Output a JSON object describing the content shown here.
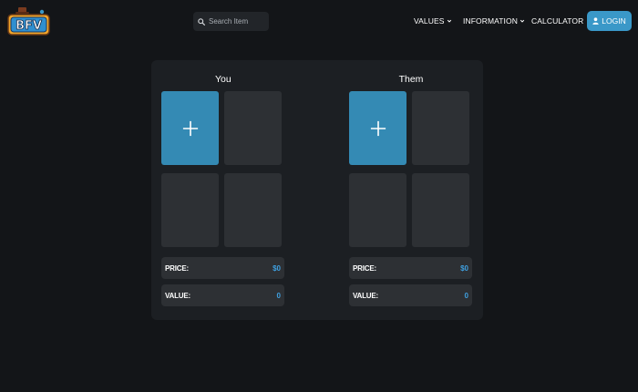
{
  "header": {
    "logo_text": "BFV",
    "search": {
      "placeholder": "Search Item",
      "value": ""
    },
    "nav": {
      "values_label": "VALUES",
      "information_label": "INFORMATION",
      "calculator_label": "CALCULATOR"
    },
    "login_label": "LOGIN"
  },
  "trade": {
    "you": {
      "title": "You",
      "price_label": "PRICE:",
      "price_value": "$0",
      "value_label": "VALUE:",
      "value_value": "0"
    },
    "them": {
      "title": "Them",
      "price_label": "PRICE:",
      "price_value": "$0",
      "value_label": "VALUE:",
      "value_value": "0"
    }
  },
  "colors": {
    "background": "#131518",
    "panel": "#1c1f23",
    "slot": "#2d3034",
    "add_slot": "#348ab4",
    "accent": "#3a98c8",
    "value_text": "#3fa0e0"
  },
  "icons": {
    "search": "search-icon",
    "chevron": "chevron-down-icon",
    "user": "user-icon",
    "add": "plus-icon"
  }
}
